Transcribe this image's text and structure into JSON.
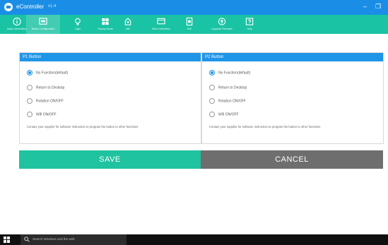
{
  "titlebar": {
    "title": "eController",
    "version": "v1.4",
    "minimize": "–",
    "restore": "❐"
  },
  "toolbar": {
    "items": [
      {
        "label": "Basic Information",
        "icon": "info-icon"
      },
      {
        "label": "Button Configuration",
        "icon": "button-config-icon"
      },
      {
        "label": "Light",
        "icon": "light-icon"
      },
      {
        "label": "Display Mode",
        "icon": "display-mode-icon"
      },
      {
        "label": "Wifi",
        "icon": "wifi-icon"
      },
      {
        "label": "Stick Calibration",
        "icon": "stick-calibration-icon"
      },
      {
        "label": "Edit",
        "icon": "edit-icon"
      },
      {
        "label": "Upgrade Firmware",
        "icon": "upgrade-icon"
      },
      {
        "label": "Help",
        "icon": "help-icon"
      }
    ],
    "active_index": 1
  },
  "p1": {
    "title": "P1 Button",
    "options": [
      "No Function(default)",
      "Return to Desktop",
      "Rotation ON/OFF",
      "Wifi ON/OFF"
    ],
    "selected": 0,
    "note": "Contact your supplier for software instruction to program the button to other functions"
  },
  "p2": {
    "title": "P2 Button",
    "options": [
      "No Function(default)",
      "Return to Desktop",
      "Rotation ON/OFF",
      "Wifi ON/OFF"
    ],
    "selected": 0,
    "note": "Contact your supplier for software instruction to program the button to other functions"
  },
  "actions": {
    "save": "SAVE",
    "cancel": "CANCEL"
  },
  "taskbar": {
    "search_placeholder": "Search Windows and the web"
  },
  "colors": {
    "titlebar": "#1a8ee6",
    "toolbar": "#19c3a3",
    "panel_header": "#1f95e8",
    "save": "#1fc3a0",
    "cancel": "#6e6e6e"
  }
}
